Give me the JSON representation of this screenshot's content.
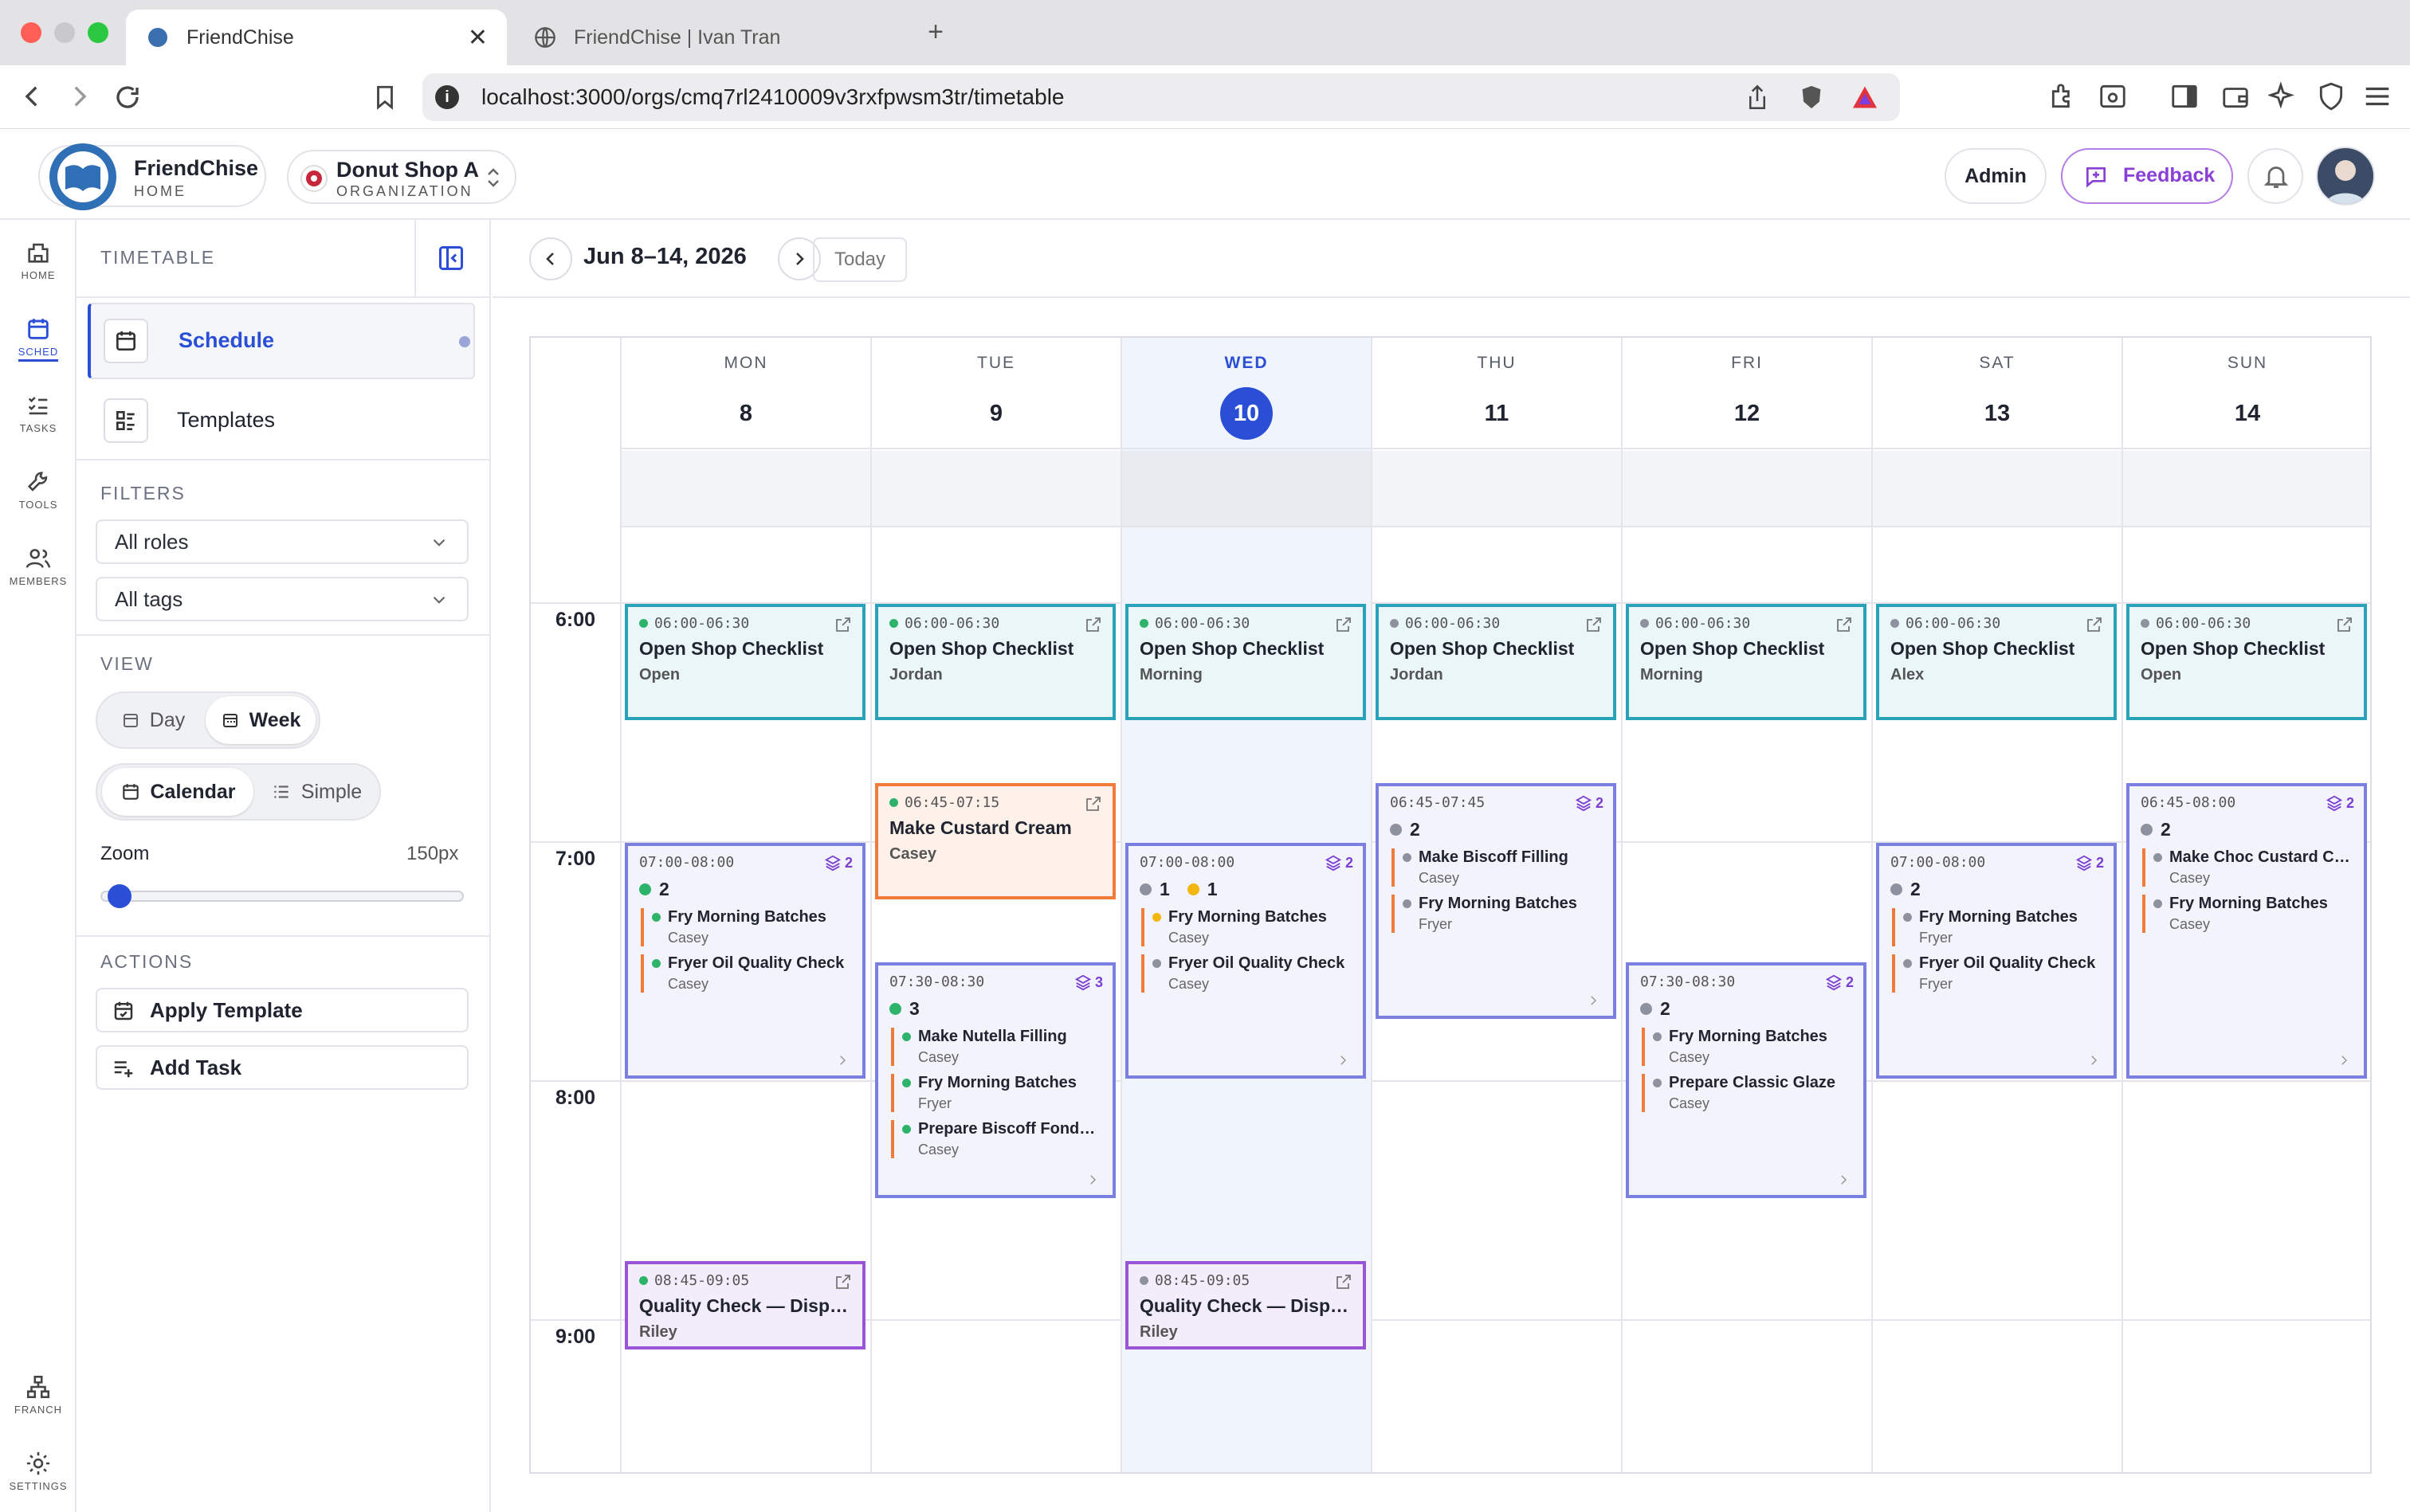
{
  "browser": {
    "tabs": [
      {
        "title": "FriendChise"
      },
      {
        "title": "FriendChise | Ivan Tran"
      }
    ],
    "url": "localhost:3000/orgs/cmq7rl2410009v3rxfpwsm3tr/timetable"
  },
  "header": {
    "brand": {
      "name": "FriendChise",
      "sub": "HOME"
    },
    "org": {
      "name": "Donut Shop A",
      "sub": "ORGANIZATION"
    },
    "admin_label": "Admin",
    "feedback_label": "Feedback"
  },
  "rail": [
    {
      "label": "HOME"
    },
    {
      "label": "SCHED"
    },
    {
      "label": "TASKS"
    },
    {
      "label": "TOOLS"
    },
    {
      "label": "MEMBERS"
    },
    {
      "label": "FRANCH"
    },
    {
      "label": "SETTINGS"
    }
  ],
  "panel": {
    "section_title": "TIMETABLE",
    "nav": [
      {
        "label": "Schedule"
      },
      {
        "label": "Templates"
      }
    ],
    "filters_title": "FILTERS",
    "filter_roles": "All roles",
    "filter_tags": "All tags",
    "view_title": "VIEW",
    "view_day": "Day",
    "view_week": "Week",
    "view_calendar": "Calendar",
    "view_simple": "Simple",
    "zoom_label": "Zoom",
    "zoom_value": "150px",
    "zoom_fraction": 0.02,
    "actions_title": "ACTIONS",
    "apply_template": "Apply Template",
    "add_task": "Add Task"
  },
  "toolbar": {
    "range": "Jun 8–14, 2026",
    "today": "Today"
  },
  "calendar": {
    "days": [
      {
        "dow": "MON",
        "num": "8"
      },
      {
        "dow": "TUE",
        "num": "9"
      },
      {
        "dow": "WED",
        "num": "10",
        "today": true
      },
      {
        "dow": "THU",
        "num": "11"
      },
      {
        "dow": "FRI",
        "num": "12"
      },
      {
        "dow": "SAT",
        "num": "13"
      },
      {
        "dow": "SUN",
        "num": "14"
      }
    ],
    "hours": [
      "6:00",
      "7:00",
      "8:00",
      "9:00"
    ],
    "events": [
      {
        "day": 0,
        "kind": "single",
        "style": "teal",
        "time": "06:00-06:30",
        "title": "Open Shop Checklist",
        "sub": "Open",
        "dot": "#2db36a",
        "start": 6.0,
        "end": 6.5
      },
      {
        "day": 1,
        "kind": "single",
        "style": "teal",
        "time": "06:00-06:30",
        "title": "Open Shop Checklist",
        "sub": "Jordan",
        "dot": "#2db36a",
        "start": 6.0,
        "end": 6.5
      },
      {
        "day": 2,
        "kind": "single",
        "style": "teal",
        "time": "06:00-06:30",
        "title": "Open Shop Checklist",
        "sub": "Morning",
        "dot": "#2db36a",
        "start": 6.0,
        "end": 6.5
      },
      {
        "day": 3,
        "kind": "single",
        "style": "teal",
        "time": "06:00-06:30",
        "title": "Open Shop Checklist",
        "sub": "Jordan",
        "dot": "#8e929e",
        "start": 6.0,
        "end": 6.5
      },
      {
        "day": 4,
        "kind": "single",
        "style": "teal",
        "time": "06:00-06:30",
        "title": "Open Shop Checklist",
        "sub": "Morning",
        "dot": "#8e929e",
        "start": 6.0,
        "end": 6.5
      },
      {
        "day": 5,
        "kind": "single",
        "style": "teal",
        "time": "06:00-06:30",
        "title": "Open Shop Checklist",
        "sub": "Alex",
        "dot": "#8e929e",
        "start": 6.0,
        "end": 6.5
      },
      {
        "day": 6,
        "kind": "single",
        "style": "teal",
        "time": "06:00-06:30",
        "title": "Open Shop Checklist",
        "sub": "Open",
        "dot": "#8e929e",
        "start": 6.0,
        "end": 6.5
      },
      {
        "day": 1,
        "kind": "single",
        "style": "orange",
        "time": "06:45-07:15",
        "title": "Make Custard Cream",
        "sub": "Casey",
        "dot": "#2db36a",
        "start": 6.75,
        "end": 7.25
      },
      {
        "day": 3,
        "kind": "group",
        "time": "06:45-07:45",
        "badge": "2",
        "counts": [
          {
            "n": "2",
            "c": "#8e929e"
          }
        ],
        "start": 6.75,
        "end": 7.75,
        "items": [
          {
            "t": "Make Biscoff Filling",
            "r": "Casey",
            "c": "#8e929e"
          },
          {
            "t": "Fry Morning Batches",
            "r": "Fryer",
            "c": "#8e929e"
          }
        ]
      },
      {
        "day": 6,
        "kind": "group",
        "time": "06:45-08:00",
        "badge": "2",
        "counts": [
          {
            "n": "2",
            "c": "#8e929e"
          }
        ],
        "start": 6.75,
        "end": 8.0,
        "items": [
          {
            "t": "Make Choc Custard Cr...",
            "r": "Casey",
            "c": "#8e929e"
          },
          {
            "t": "Fry Morning Batches",
            "r": "Casey",
            "c": "#8e929e"
          }
        ]
      },
      {
        "day": 0,
        "kind": "group",
        "time": "07:00-08:00",
        "badge": "2",
        "counts": [
          {
            "n": "2",
            "c": "#2db36a"
          }
        ],
        "start": 7.0,
        "end": 8.0,
        "items": [
          {
            "t": "Fry Morning Batches",
            "r": "Casey",
            "c": "#2db36a"
          },
          {
            "t": "Fryer Oil Quality Check",
            "r": "Casey",
            "c": "#2db36a"
          }
        ]
      },
      {
        "day": 2,
        "kind": "group",
        "time": "07:00-08:00",
        "badge": "2",
        "counts": [
          {
            "n": "1",
            "c": "#8e929e"
          },
          {
            "n": "1",
            "c": "#f2b70f"
          }
        ],
        "start": 7.0,
        "end": 8.0,
        "items": [
          {
            "t": "Fry Morning Batches",
            "r": "Casey",
            "c": "#f2b70f"
          },
          {
            "t": "Fryer Oil Quality Check",
            "r": "Casey",
            "c": "#8e929e"
          }
        ]
      },
      {
        "day": 5,
        "kind": "group",
        "time": "07:00-08:00",
        "badge": "2",
        "counts": [
          {
            "n": "2",
            "c": "#8e929e"
          }
        ],
        "start": 7.0,
        "end": 8.0,
        "items": [
          {
            "t": "Fry Morning Batches",
            "r": "Fryer",
            "c": "#8e929e"
          },
          {
            "t": "Fryer Oil Quality Check",
            "r": "Fryer",
            "c": "#8e929e"
          }
        ]
      },
      {
        "day": 1,
        "kind": "group",
        "time": "07:30-08:30",
        "badge": "3",
        "counts": [
          {
            "n": "3",
            "c": "#2db36a"
          }
        ],
        "start": 7.5,
        "end": 8.5,
        "items": [
          {
            "t": "Make Nutella Filling",
            "r": "Casey",
            "c": "#2db36a"
          },
          {
            "t": "Fry Morning Batches",
            "r": "Fryer",
            "c": "#2db36a"
          },
          {
            "t": "Prepare Biscoff Fondant",
            "r": "Casey",
            "c": "#2db36a"
          }
        ]
      },
      {
        "day": 4,
        "kind": "group",
        "time": "07:30-08:30",
        "badge": "2",
        "counts": [
          {
            "n": "2",
            "c": "#8e929e"
          }
        ],
        "start": 7.5,
        "end": 8.5,
        "items": [
          {
            "t": "Fry Morning Batches",
            "r": "Casey",
            "c": "#8e929e"
          },
          {
            "t": "Prepare Classic Glaze",
            "r": "Casey",
            "c": "#8e929e"
          }
        ]
      },
      {
        "day": 0,
        "kind": "single",
        "style": "purple",
        "time": "08:45-09:05",
        "title": "Quality Check — Displa...",
        "sub": "Riley",
        "dot": "#2db36a",
        "start": 8.75,
        "end": 9.1333
      },
      {
        "day": 2,
        "kind": "single",
        "style": "purple",
        "time": "08:45-09:05",
        "title": "Quality Check — Displa...",
        "sub": "Riley",
        "dot": "#8e929e",
        "start": 8.75,
        "end": 9.1333
      }
    ]
  }
}
